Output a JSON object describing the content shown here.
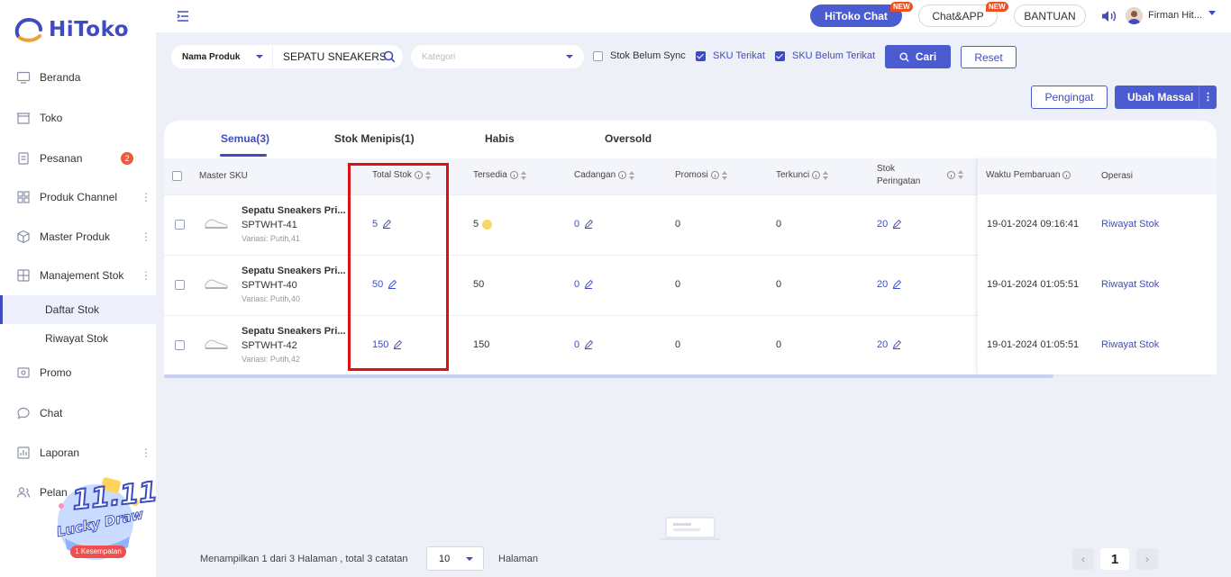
{
  "brand": {
    "name": "HiToko"
  },
  "sidebar": {
    "items": [
      {
        "label": "Beranda",
        "icon": "monitor-icon"
      },
      {
        "label": "Toko",
        "icon": "store-icon"
      },
      {
        "label": "Pesanan",
        "icon": "order-icon",
        "badge": "2"
      },
      {
        "label": "Produk Channel",
        "icon": "grid-icon"
      },
      {
        "label": "Master Produk",
        "icon": "box-icon"
      },
      {
        "label": "Manajement Stok",
        "icon": "stock-icon"
      },
      {
        "label": "Daftar Stok"
      },
      {
        "label": "Riwayat Stok"
      },
      {
        "label": "Promo",
        "icon": "promo-icon"
      },
      {
        "label": "Chat",
        "icon": "chat-icon"
      },
      {
        "label": "Laporan",
        "icon": "report-icon"
      },
      {
        "label": "Pelan",
        "icon": "customer-icon"
      }
    ]
  },
  "promo_banner": {
    "line1": "11.11",
    "line2": "Lucky Draw",
    "tag": "1 Kesempatan"
  },
  "topbar": {
    "hitoko_chat": "HiToko Chat",
    "chat_app": "Chat&APP",
    "new_tag": "NEW",
    "bantuan": "BANTUAN",
    "username": "Firman Hit..."
  },
  "filters": {
    "field_select": "Nama Produk",
    "search_value": "SEPATU SNEAKERS",
    "kategori_placeholder": "Kategori",
    "stok_belum_sync": "Stok Belum Sync",
    "sku_terikat": "SKU Terikat",
    "sku_belum_terikat": "SKU Belum Terikat",
    "cari": "Cari",
    "reset": "Reset"
  },
  "actions": {
    "pengingat": "Pengingat",
    "ubah_massal": "Ubah Massal"
  },
  "tabs": [
    {
      "label": "Semua(3)"
    },
    {
      "label": "Stok Menipis(1)"
    },
    {
      "label": "Habis"
    },
    {
      "label": "Oversold"
    }
  ],
  "table": {
    "headers": {
      "master_sku": "Master SKU",
      "total_stok": "Total Stok",
      "tersedia": "Tersedia",
      "cadangan": "Cadangan",
      "promosi": "Promosi",
      "terkunci": "Terkunci",
      "stok_peringatan_1": "Stok",
      "stok_peringatan_2": "Peringatan",
      "waktu_pembaruan": "Waktu Pembaruan",
      "operasi": "Operasi"
    },
    "rows": [
      {
        "name": "Sepatu Sneakers Pri...",
        "sku": "SPTWHT-41",
        "variant": "Variasi: Putih,41",
        "total_stok": "5",
        "tersedia": "5",
        "cadangan": "0",
        "promosi": "0",
        "terkunci": "0",
        "stok_peringatan": "20",
        "waktu": "19-01-2024 09:16:41",
        "operasi": "Riwayat Stok"
      },
      {
        "name": "Sepatu Sneakers Pri...",
        "sku": "SPTWHT-40",
        "variant": "Variasi: Putih,40",
        "total_stok": "50",
        "tersedia": "50",
        "cadangan": "0",
        "promosi": "0",
        "terkunci": "0",
        "stok_peringatan": "20",
        "waktu": "19-01-2024 01:05:51",
        "operasi": "Riwayat Stok"
      },
      {
        "name": "Sepatu Sneakers Pri...",
        "sku": "SPTWHT-42",
        "variant": "Variasi: Putih,42",
        "total_stok": "150",
        "tersedia": "150",
        "cadangan": "0",
        "promosi": "0",
        "terkunci": "0",
        "stok_peringatan": "20",
        "waktu": "19-01-2024 01:05:51",
        "operasi": "Riwayat Stok"
      }
    ]
  },
  "pagination": {
    "summary": "Menampilkan 1 dari 3 Halaman , total 3 catatan",
    "page_size": "10",
    "halaman": "Halaman",
    "current_page": "1"
  },
  "colors": {
    "accent": "#4b5bd0",
    "highlight": "#e01010",
    "badge": "#ee5a3a",
    "new_tag": "#f04f23"
  }
}
